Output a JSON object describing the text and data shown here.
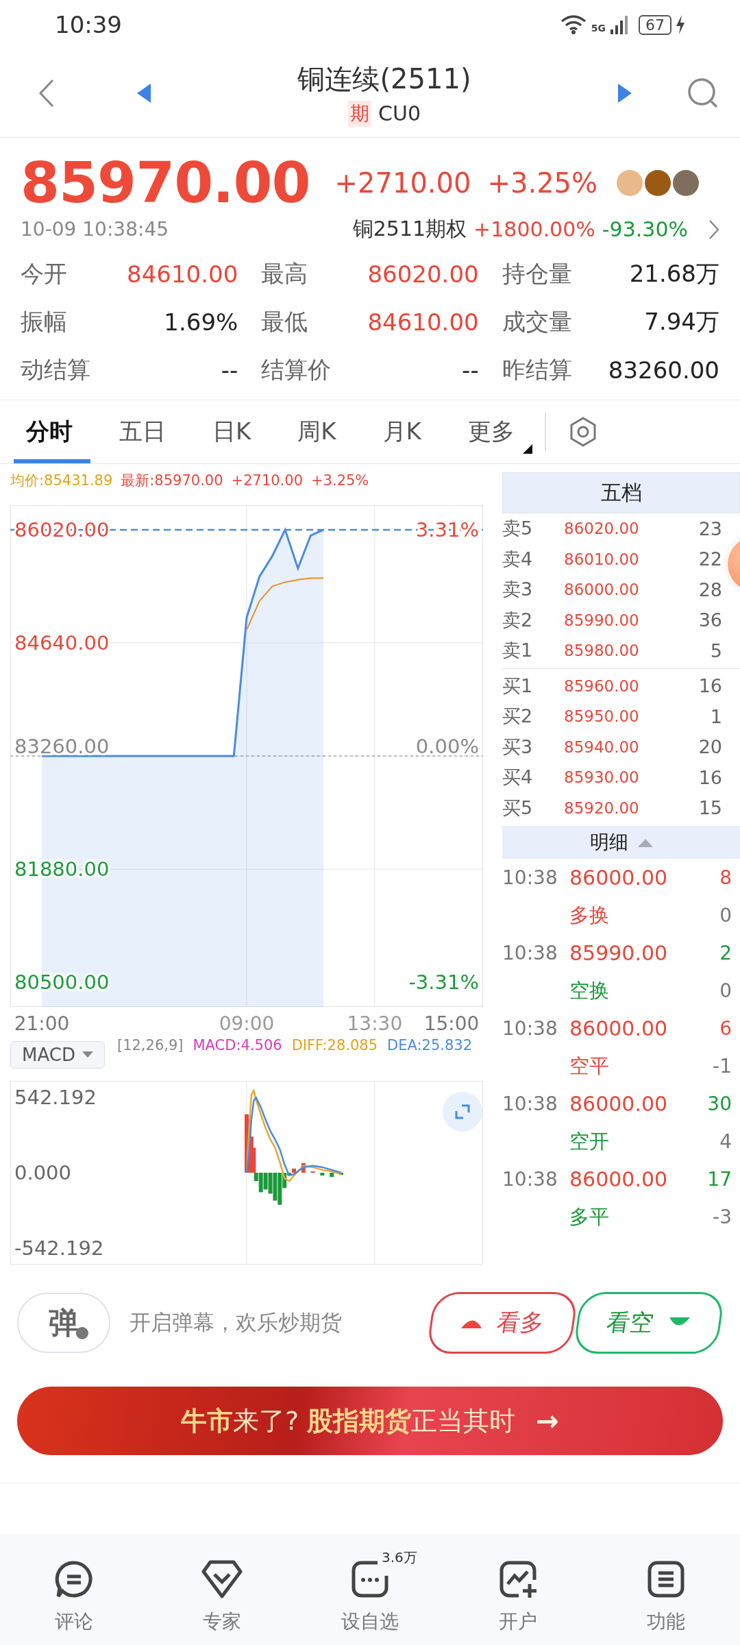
{
  "status_bar": {
    "time": "10:39",
    "network": "5G",
    "battery": "67"
  },
  "header": {
    "title": "铜连续(2511)",
    "tag": "期",
    "code": "CU0"
  },
  "quote": {
    "price": "85970.00",
    "change": "+2710.00",
    "change_pct": "+3.25%",
    "datetime": "10-09 10:38:45",
    "option_name": "铜2511期权",
    "option_up": "+1800.00%",
    "option_down": "-93.30%"
  },
  "stats": [
    {
      "label": "今开",
      "value": "84610.00",
      "color": "#e8483b"
    },
    {
      "label": "最高",
      "value": "86020.00",
      "color": "#e8483b"
    },
    {
      "label": "持仓量",
      "value": "21.68万",
      "color": "#222222"
    },
    {
      "label": "振幅",
      "value": "1.69%",
      "color": "#222222"
    },
    {
      "label": "最低",
      "value": "84610.00",
      "color": "#e8483b"
    },
    {
      "label": "成交量",
      "value": "7.94万",
      "color": "#222222"
    },
    {
      "label": "动结算",
      "value": "--",
      "color": "#222222"
    },
    {
      "label": "结算价",
      "value": "--",
      "color": "#222222"
    },
    {
      "label": "昨结算",
      "value": "83260.00",
      "color": "#222222"
    }
  ],
  "tabs": [
    {
      "label": "分时",
      "selected": true
    },
    {
      "label": "五日",
      "selected": false
    },
    {
      "label": "日K",
      "selected": false
    },
    {
      "label": "周K",
      "selected": false
    },
    {
      "label": "月K",
      "selected": false
    },
    {
      "label": "更多",
      "selected": false
    }
  ],
  "chart_info": {
    "avg": "均价:85431.89",
    "latest": "最新:85970.00",
    "change": "+2710.00",
    "change_pct": "+3.25%"
  },
  "price_chart": {
    "chart_data": {
      "type": "line",
      "grid": true,
      "ref_lines": [
        {
          "axis": "y",
          "value": 86020,
          "color": "#4a8be0"
        },
        {
          "axis": "y",
          "value": 83260,
          "color": "#aaaaaa"
        }
      ],
      "categories": [
        "21:00",
        null,
        null,
        null,
        null,
        null,
        null,
        null,
        null,
        null,
        null,
        null,
        null,
        null,
        null,
        null,
        "09:00",
        null,
        null,
        null,
        null,
        null,
        null,
        null,
        null,
        null,
        "13:30",
        null,
        null,
        null,
        null,
        null,
        "15:00"
      ],
      "series": [
        {
          "type": "area",
          "color": "#4a8be0",
          "values": [
            83260,
            83260,
            83260,
            83260,
            83260,
            83260,
            83260,
            83260,
            83260,
            83260,
            83260,
            83260,
            83260,
            83260,
            83260,
            83260,
            84950,
            85450,
            85700,
            86020,
            85550,
            85950,
            86020,
            null,
            null,
            null,
            null,
            null,
            null,
            null,
            null,
            null,
            null
          ]
        },
        {
          "type": "line",
          "color": "#e8912f",
          "values": [
            null,
            null,
            null,
            null,
            null,
            null,
            null,
            null,
            null,
            null,
            null,
            null,
            null,
            null,
            null,
            null,
            84800,
            85150,
            85330,
            85380,
            85410,
            85430,
            85430,
            null,
            null,
            null,
            null,
            null,
            null,
            null,
            null,
            null,
            null
          ]
        }
      ],
      "ylim": [
        80200,
        86320
      ],
      "yticks": [
        {
          "value": 86020,
          "label": "86020.00"
        },
        {
          "value": 84640,
          "label": "84640.00"
        },
        {
          "value": 83260,
          "label": "83260.00"
        },
        {
          "value": 81880,
          "label": "81880.00"
        },
        {
          "value": 80500,
          "label": "80500.00"
        }
      ]
    },
    "percent_labels": [
      "3.31%",
      "0.00%",
      "-3.31%"
    ]
  },
  "indicator": {
    "name": "MACD",
    "params": "[12,26,9]",
    "macd": "MACD:4.506",
    "diff": "DIFF:28.085",
    "dea": "DEA:25.832",
    "axis_labels": [
      "542.192",
      "0.000",
      "-542.192"
    ]
  },
  "order_book": {
    "title": "五档",
    "asks": [
      {
        "label": "卖5",
        "price": "86020.00",
        "qty": "23"
      },
      {
        "label": "卖4",
        "price": "86010.00",
        "qty": "22"
      },
      {
        "label": "卖3",
        "price": "86000.00",
        "qty": "28"
      },
      {
        "label": "卖2",
        "price": "85990.00",
        "qty": "36"
      },
      {
        "label": "卖1",
        "price": "85980.00",
        "qty": "5"
      }
    ],
    "bids": [
      {
        "label": "买1",
        "price": "85960.00",
        "qty": "16"
      },
      {
        "label": "买2",
        "price": "85950.00",
        "qty": "1"
      },
      {
        "label": "买3",
        "price": "85940.00",
        "qty": "20"
      },
      {
        "label": "买4",
        "price": "85930.00",
        "qty": "16"
      },
      {
        "label": "买5",
        "price": "85920.00",
        "qty": "15"
      }
    ]
  },
  "trades": {
    "title": "明细",
    "items": [
      {
        "time": "10:38",
        "price": "86000.00",
        "qty": "8",
        "type": "多换",
        "change": "0",
        "up": true
      },
      {
        "time": "10:38",
        "price": "85990.00",
        "qty": "2",
        "type": "空换",
        "change": "0",
        "up": false
      },
      {
        "time": "10:38",
        "price": "86000.00",
        "qty": "6",
        "type": "空平",
        "change": "-1",
        "up": true
      },
      {
        "time": "10:38",
        "price": "86000.00",
        "qty": "30",
        "type": "空开",
        "change": "4",
        "up": false
      },
      {
        "time": "10:38",
        "price": "86000.00",
        "qty": "17",
        "type": "多平",
        "change": "-3",
        "up": false
      }
    ]
  },
  "danmaku": {
    "icon_text": "弹",
    "placeholder": "开启弹幕，欢乐炒期货"
  },
  "vote": {
    "bull": "看多",
    "bear": "看空"
  },
  "banner": {
    "text": "**牛市**来了? **股指期货**正当其时",
    "arrow": "→"
  },
  "bottom_nav": [
    {
      "label": "评论"
    },
    {
      "label": "专家"
    },
    {
      "label": "设自选",
      "badge": "3.6万"
    },
    {
      "label": "开户"
    },
    {
      "label": "功能"
    }
  ]
}
